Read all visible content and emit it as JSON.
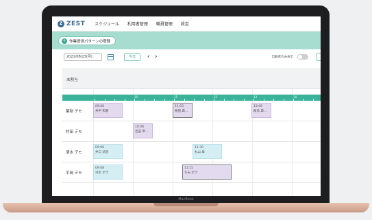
{
  "app": {
    "logo": "ZEST",
    "nav": [
      "スケジュール",
      "利用者管理",
      "職員管理",
      "設定"
    ]
  },
  "band": {
    "pattern_button_label": "作業提供パターンの登録"
  },
  "toolbar": {
    "date_value": "2021/08/23(月)",
    "today_label": "今日",
    "prev_arrow": "‹",
    "next_arrow": "›",
    "filter_label": "出勤者のみ表示"
  },
  "grid": {
    "unassigned_label": "未割当",
    "hour_labels": [
      "10",
      "11",
      "12",
      "13",
      "14"
    ],
    "rows": [
      {
        "name": "薬剤 デモ",
        "events": [
          {
            "time": "09:08",
            "person": "井手 和嘉",
            "color": "purple"
          },
          {
            "time": "11:03",
            "person": "飯田 典...",
            "color": "purple"
          },
          {
            "time": "13:08",
            "person": "飯島 典...",
            "color": "purple"
          }
        ]
      },
      {
        "name": "村田 デモ",
        "events": [
          {
            "time": "10:08",
            "person": "吉田 帝...",
            "color": "purple"
          }
        ]
      },
      {
        "name": "清水 デモ",
        "events": [
          {
            "time": "09:08",
            "person": "井口 武彦",
            "color": "cyan"
          },
          {
            "time": "11:30",
            "person": "丸山 章",
            "color": "cyan"
          }
        ]
      },
      {
        "name": "平岡 デモ",
        "events": [
          {
            "time": "09:08",
            "person": "洋太 ボウ",
            "color": "cyan"
          },
          {
            "time": "11:15",
            "person": "ちみ ボウ",
            "color": "purple"
          }
        ]
      }
    ]
  },
  "device": {
    "brand": "MacBook"
  }
}
